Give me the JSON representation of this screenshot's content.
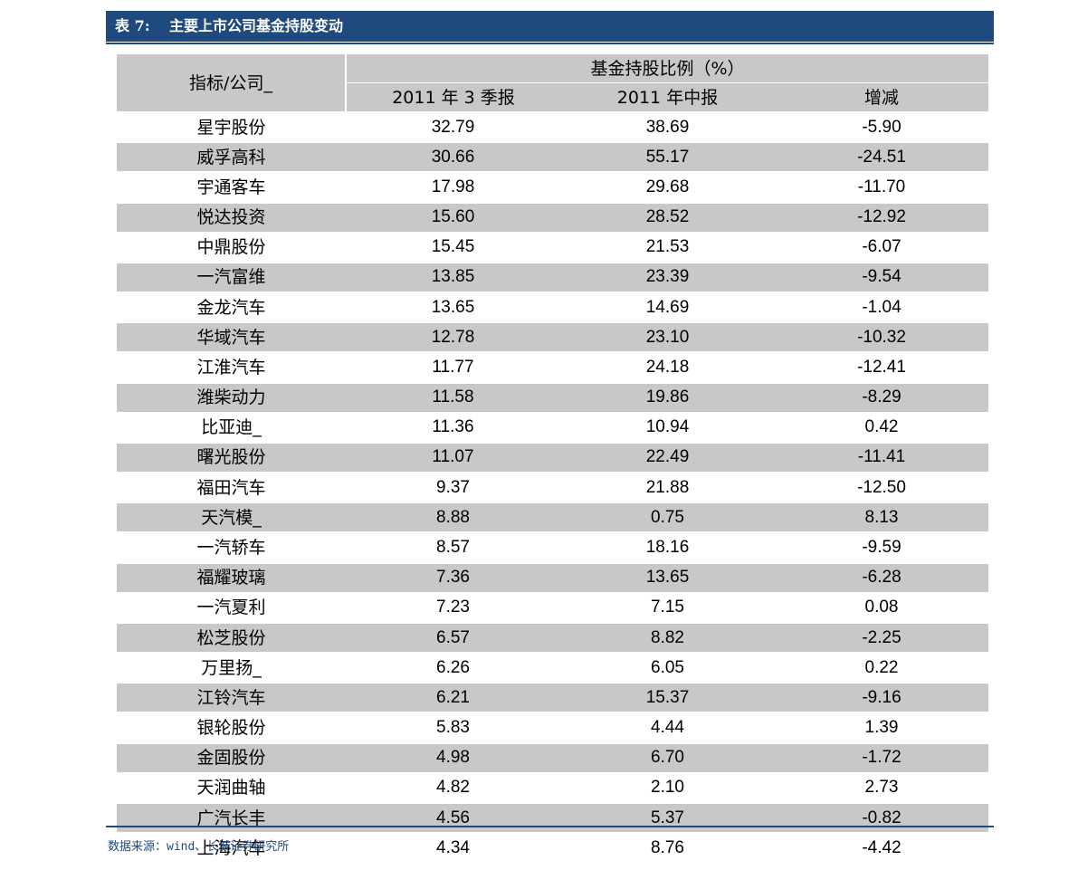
{
  "title": {
    "label": "表 7:",
    "text": "主要上市公司基金持股变动"
  },
  "table": {
    "corner_header": "指标/公司_",
    "group_header": "基金持股比例（%）",
    "columns": [
      "2011 年 3 季报",
      "2011 年中报",
      "增减"
    ],
    "rows": [
      {
        "company": "星宇股份",
        "q3": "32.79",
        "mid": "38.69",
        "change": "-5.90"
      },
      {
        "company": "威孚高科",
        "q3": "30.66",
        "mid": "55.17",
        "change": "-24.51"
      },
      {
        "company": "宇通客车",
        "q3": "17.98",
        "mid": "29.68",
        "change": "-11.70"
      },
      {
        "company": "悦达投资",
        "q3": "15.60",
        "mid": "28.52",
        "change": "-12.92"
      },
      {
        "company": "中鼎股份",
        "q3": "15.45",
        "mid": "21.53",
        "change": "-6.07"
      },
      {
        "company": "一汽富维",
        "q3": "13.85",
        "mid": "23.39",
        "change": "-9.54"
      },
      {
        "company": "金龙汽车",
        "q3": "13.65",
        "mid": "14.69",
        "change": "-1.04"
      },
      {
        "company": "华域汽车",
        "q3": "12.78",
        "mid": "23.10",
        "change": "-10.32"
      },
      {
        "company": "江淮汽车",
        "q3": "11.77",
        "mid": "24.18",
        "change": "-12.41"
      },
      {
        "company": "潍柴动力",
        "q3": "11.58",
        "mid": "19.86",
        "change": "-8.29"
      },
      {
        "company": "比亚迪_",
        "q3": "11.36",
        "mid": "10.94",
        "change": "0.42"
      },
      {
        "company": "曙光股份",
        "q3": "11.07",
        "mid": "22.49",
        "change": "-11.41"
      },
      {
        "company": "福田汽车",
        "q3": "9.37",
        "mid": "21.88",
        "change": "-12.50"
      },
      {
        "company": "天汽模_",
        "q3": "8.88",
        "mid": "0.75",
        "change": "8.13"
      },
      {
        "company": "一汽轿车",
        "q3": "8.57",
        "mid": "18.16",
        "change": "-9.59"
      },
      {
        "company": "福耀玻璃",
        "q3": "7.36",
        "mid": "13.65",
        "change": "-6.28"
      },
      {
        "company": "一汽夏利",
        "q3": "7.23",
        "mid": "7.15",
        "change": "0.08"
      },
      {
        "company": "松芝股份",
        "q3": "6.57",
        "mid": "8.82",
        "change": "-2.25"
      },
      {
        "company": "万里扬_",
        "q3": "6.26",
        "mid": "6.05",
        "change": "0.22"
      },
      {
        "company": "江铃汽车",
        "q3": "6.21",
        "mid": "15.37",
        "change": "-9.16"
      },
      {
        "company": "银轮股份",
        "q3": "5.83",
        "mid": "4.44",
        "change": "1.39"
      },
      {
        "company": "金固股份",
        "q3": "4.98",
        "mid": "6.70",
        "change": "-1.72"
      },
      {
        "company": "天润曲轴",
        "q3": "4.82",
        "mid": "2.10",
        "change": "2.73"
      },
      {
        "company": "广汽长丰",
        "q3": "4.56",
        "mid": "5.37",
        "change": "-0.82"
      },
      {
        "company": "上海汽车",
        "q3": "4.34",
        "mid": "8.76",
        "change": "-4.42"
      }
    ]
  },
  "source": "数据来源：wind、长城证券研究所",
  "colors": {
    "title_bg": "#1f4a7e",
    "row_stripe": "#c8c8c8"
  }
}
